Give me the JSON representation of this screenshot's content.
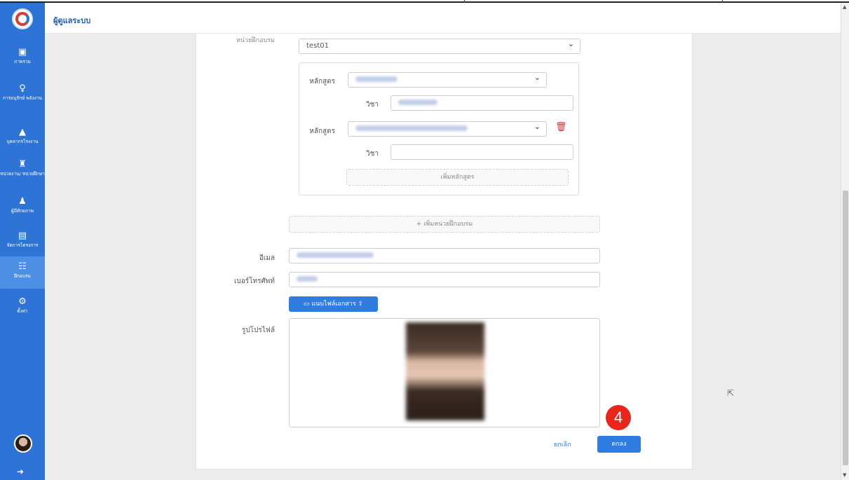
{
  "app": {
    "header_title": "ผู้ดูแลระบบ"
  },
  "sidebar": {
    "items": [
      {
        "icon": "monitor-icon",
        "glyph": "▣",
        "label": "ภาพรวม"
      },
      {
        "icon": "lightbulb-icon",
        "glyph": "♀",
        "label": "การอนุรักษ์ พลังงาน"
      },
      {
        "icon": "factory-icon",
        "glyph": "▲",
        "label": "บุคลากรโรงงาน"
      },
      {
        "icon": "person-badge-icon",
        "glyph": "♜",
        "label": "หน่วยงาน/ หน่วยฝึกษา"
      },
      {
        "icon": "user-icon",
        "glyph": "♟",
        "label": "ผู้มีศักยภาพ"
      },
      {
        "icon": "clipboard-icon",
        "glyph": "▤",
        "label": "จัดการโครงการ"
      },
      {
        "icon": "training-icon",
        "glyph": "☷",
        "label": "ฝึกอบรม",
        "active": true
      },
      {
        "icon": "gear-icon",
        "glyph": "⚙",
        "label": "ตั้งค่า"
      }
    ]
  },
  "form": {
    "unit_label": "หน่วยฝึกอบรม",
    "unit_value": "test01",
    "course_label": "หลักสูตร",
    "subject_label": "วิชา",
    "add_course_label": "เพิ่มหลักสูตร",
    "add_unit_label": "+ เพิ่มหน่วยฝึกอบรม",
    "email_label": "อีเมล",
    "phone_label": "เบอร์โทรศัพท์",
    "attach_label": "แนบไฟล์เอกสาร",
    "profile_label": "รูปโปรไฟล์",
    "cancel_label": "ยกเลิก",
    "ok_label": "ตกลง"
  },
  "annotation": {
    "step_number": "4"
  },
  "colors": {
    "sidebar": "#2d74d6",
    "primary": "#2f7de1",
    "step_badge": "#e8261c",
    "delete": "#d32f2f"
  }
}
